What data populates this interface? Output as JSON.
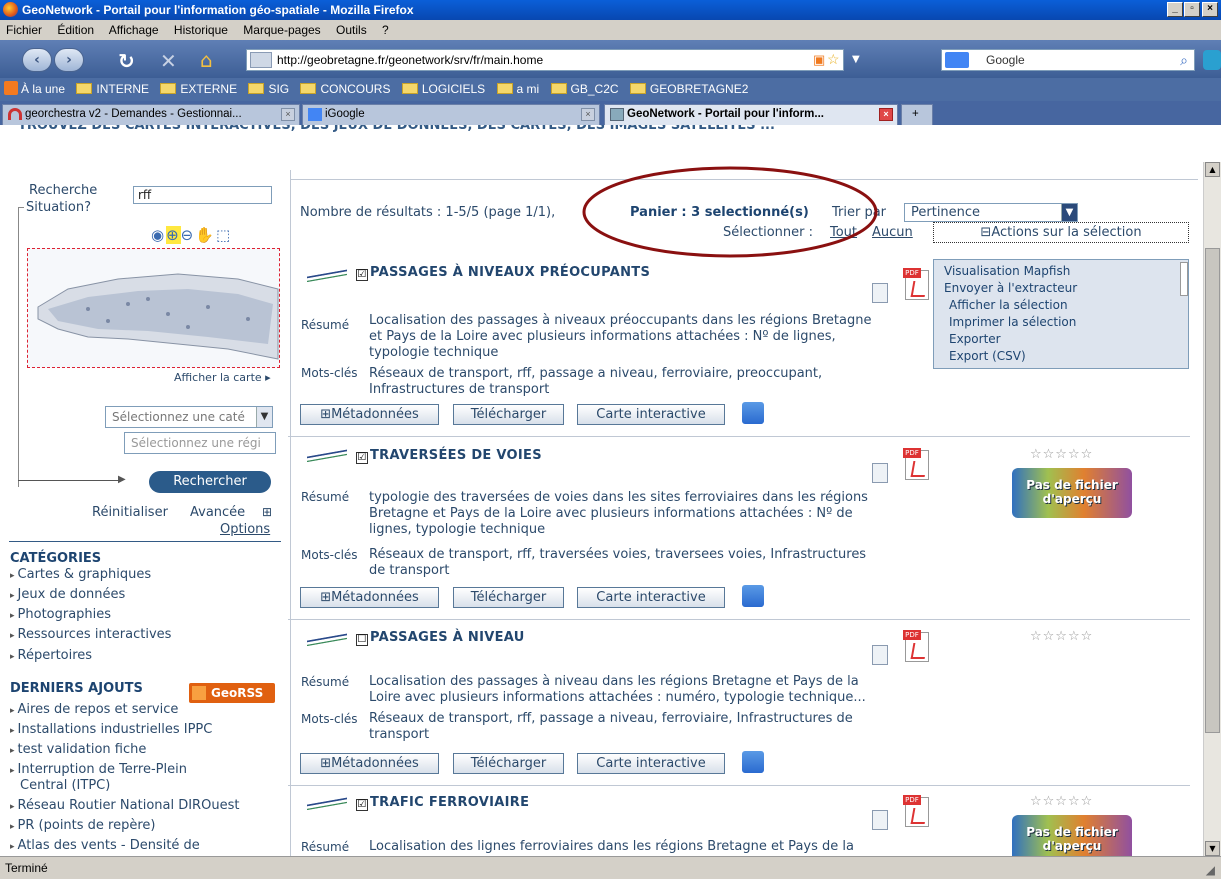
{
  "window": {
    "title": "GeoNetwork - Portail pour l'information géo-spatiale - Mozilla Firefox",
    "min": "_",
    "max": "▫",
    "close": "×"
  },
  "menu": [
    "Fichier",
    "Édition",
    "Affichage",
    "Historique",
    "Marque-pages",
    "Outils",
    "?"
  ],
  "nav": {
    "url": "http://geobretagne.fr/geonetwork/srv/fr/main.home",
    "search_placeholder": "Google"
  },
  "bookmarks": [
    "À la une",
    "INTERNE",
    "EXTERNE",
    "SIG",
    "CONCOURS",
    "LOGICIELS",
    "a mi",
    "GB_C2C",
    "GEOBRETAGNE2"
  ],
  "tabs": [
    {
      "label": "georchestra v2 - Demandes - Gestionnai..."
    },
    {
      "label": "iGoogle"
    },
    {
      "label": "GeoNetwork - Portail pour l'inform..."
    }
  ],
  "banner": "TROUVEZ DES CARTES INTERACTIVES, DES JEUX DE DONNÉES, DES CARTES, DES IMAGES SATELLITES ...",
  "left": {
    "search_label": "Recherche",
    "search_value": "rff",
    "situation_label": "Situation?",
    "show_map": "Afficher la carte ▸",
    "select_cat": "Sélectionnez une caté",
    "select_reg": "Sélectionnez une régi",
    "search_button": "Rechercher",
    "reset": "Réinitialiser",
    "advanced": "Avancée",
    "options": "Options",
    "categories_title": "CATÉGORIES",
    "categories": [
      "Cartes & graphiques",
      "Jeux de données",
      "Photographies",
      "Ressources interactives",
      "Répertoires"
    ],
    "recent_title": "DERNIERS AJOUTS",
    "georss": "GeoRSS",
    "recent": [
      "Aires de repos et service",
      "Installations industrielles IPPC",
      "test validation fiche",
      "Interruption de Terre-Plein",
      "Central (ITPC)",
      "Réseau Routier National DIROuest",
      "PR (points de repère)",
      "Atlas des vents - Densité de"
    ]
  },
  "summary": {
    "count": "Nombre de résultats :  1-5/5  (page 1/1),",
    "basket": "Panier : 3 selectionné(s)",
    "sort_label": "Trier par",
    "sort_value": "Pertinence",
    "select_label": "Sélectionner :",
    "select_all": "Tout",
    "select_none": "Aucun",
    "actions": "⊟Actions sur la sélection"
  },
  "actions_menu": [
    "Visualisation Mapfish",
    "Envoyer à l'extracteur",
    "Afficher la sélection",
    "Imprimer la sélection",
    "Exporter",
    "Export (CSV)"
  ],
  "labels": {
    "resume": "Résumé",
    "keywords": "Mots-clés",
    "meta": "⊞Métadonnées",
    "download": "Télécharger",
    "map": "Carte interactive",
    "stars": "☆☆☆☆☆",
    "no_preview": "Pas de fichier d'aperçu"
  },
  "results": [
    {
      "title": "PASSAGES À NIVEAUX PRÉOCUPANTS",
      "checked": "☑",
      "resume1": "Localisation des passages à niveaux préoccupants dans les régions Bretagne",
      "resume2": "et Pays de la Loire avec plusieurs informations attachées : Nº de lignes,",
      "resume3": "typologie technique",
      "kw1": "Réseaux de transport, rff, passage a niveau, ferroviaire, preoccupant,",
      "kw2": "Infrastructures de transport"
    },
    {
      "title": "TRAVERSÉES DE VOIES",
      "checked": "☑",
      "resume1": "typologie des traversées de voies dans les sites ferroviaires dans les régions",
      "resume2": "Bretagne et Pays de la Loire avec plusieurs informations attachées : Nº de",
      "resume3": "lignes, typologie technique",
      "kw1": "Réseaux de transport, rff, traversées voies, traversees voies, Infrastructures",
      "kw2": "de transport"
    },
    {
      "title": "PASSAGES À NIVEAU",
      "checked": "☐",
      "resume1": "Localisation des passages à niveau dans les régions Bretagne et Pays de la",
      "resume2": "Loire avec plusieurs informations attachées : numéro, typologie technique...",
      "resume3": "",
      "kw1": "Réseaux de transport, rff, passage a niveau, ferroviaire, Infrastructures de",
      "kw2": "transport"
    },
    {
      "title": "TRAFIC FERROVIAIRE",
      "checked": "☑",
      "resume1": "Localisation des lignes ferroviaires dans les régions Bretagne et Pays de la"
    }
  ],
  "status": "Terminé"
}
